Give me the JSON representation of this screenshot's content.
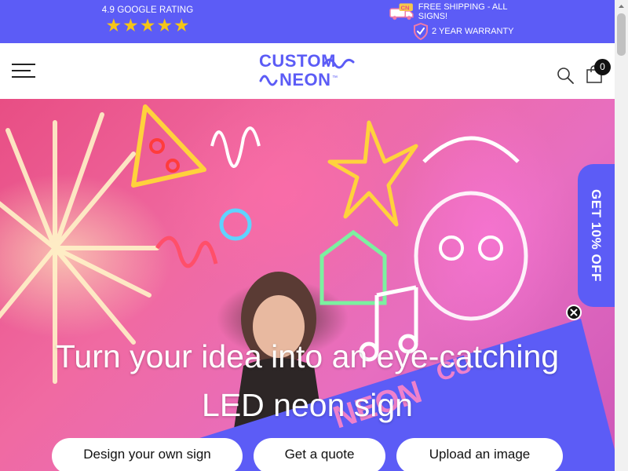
{
  "topbar": {
    "rating_text": "4.9 GOOGLE RATING",
    "stars": [
      "★",
      "★",
      "★",
      "★",
      "★"
    ],
    "shipping_text": "FREE SHIPPING - ALL SIGNS!",
    "warranty_text": "2 YEAR WARRANTY",
    "background": "#5c5cf6",
    "star_color": "#f5c518"
  },
  "header": {
    "logo_line1": "CUSTOM",
    "logo_line2": "NEON",
    "logo_tm": "™",
    "cart_count": "0",
    "icons": [
      "menu-icon",
      "search-icon",
      "cart-icon"
    ]
  },
  "hero": {
    "headline_line1": "Turn your idea into an eye-catching",
    "headline_line2": "LED neon sign",
    "buttons": [
      {
        "label": "Design your own sign"
      },
      {
        "label": "Get a quote"
      },
      {
        "label": "Upload an image"
      }
    ]
  },
  "discount_tab": {
    "label": "GET 10% OFF",
    "close_icon": "close-icon",
    "background": "#5c5cf6"
  }
}
